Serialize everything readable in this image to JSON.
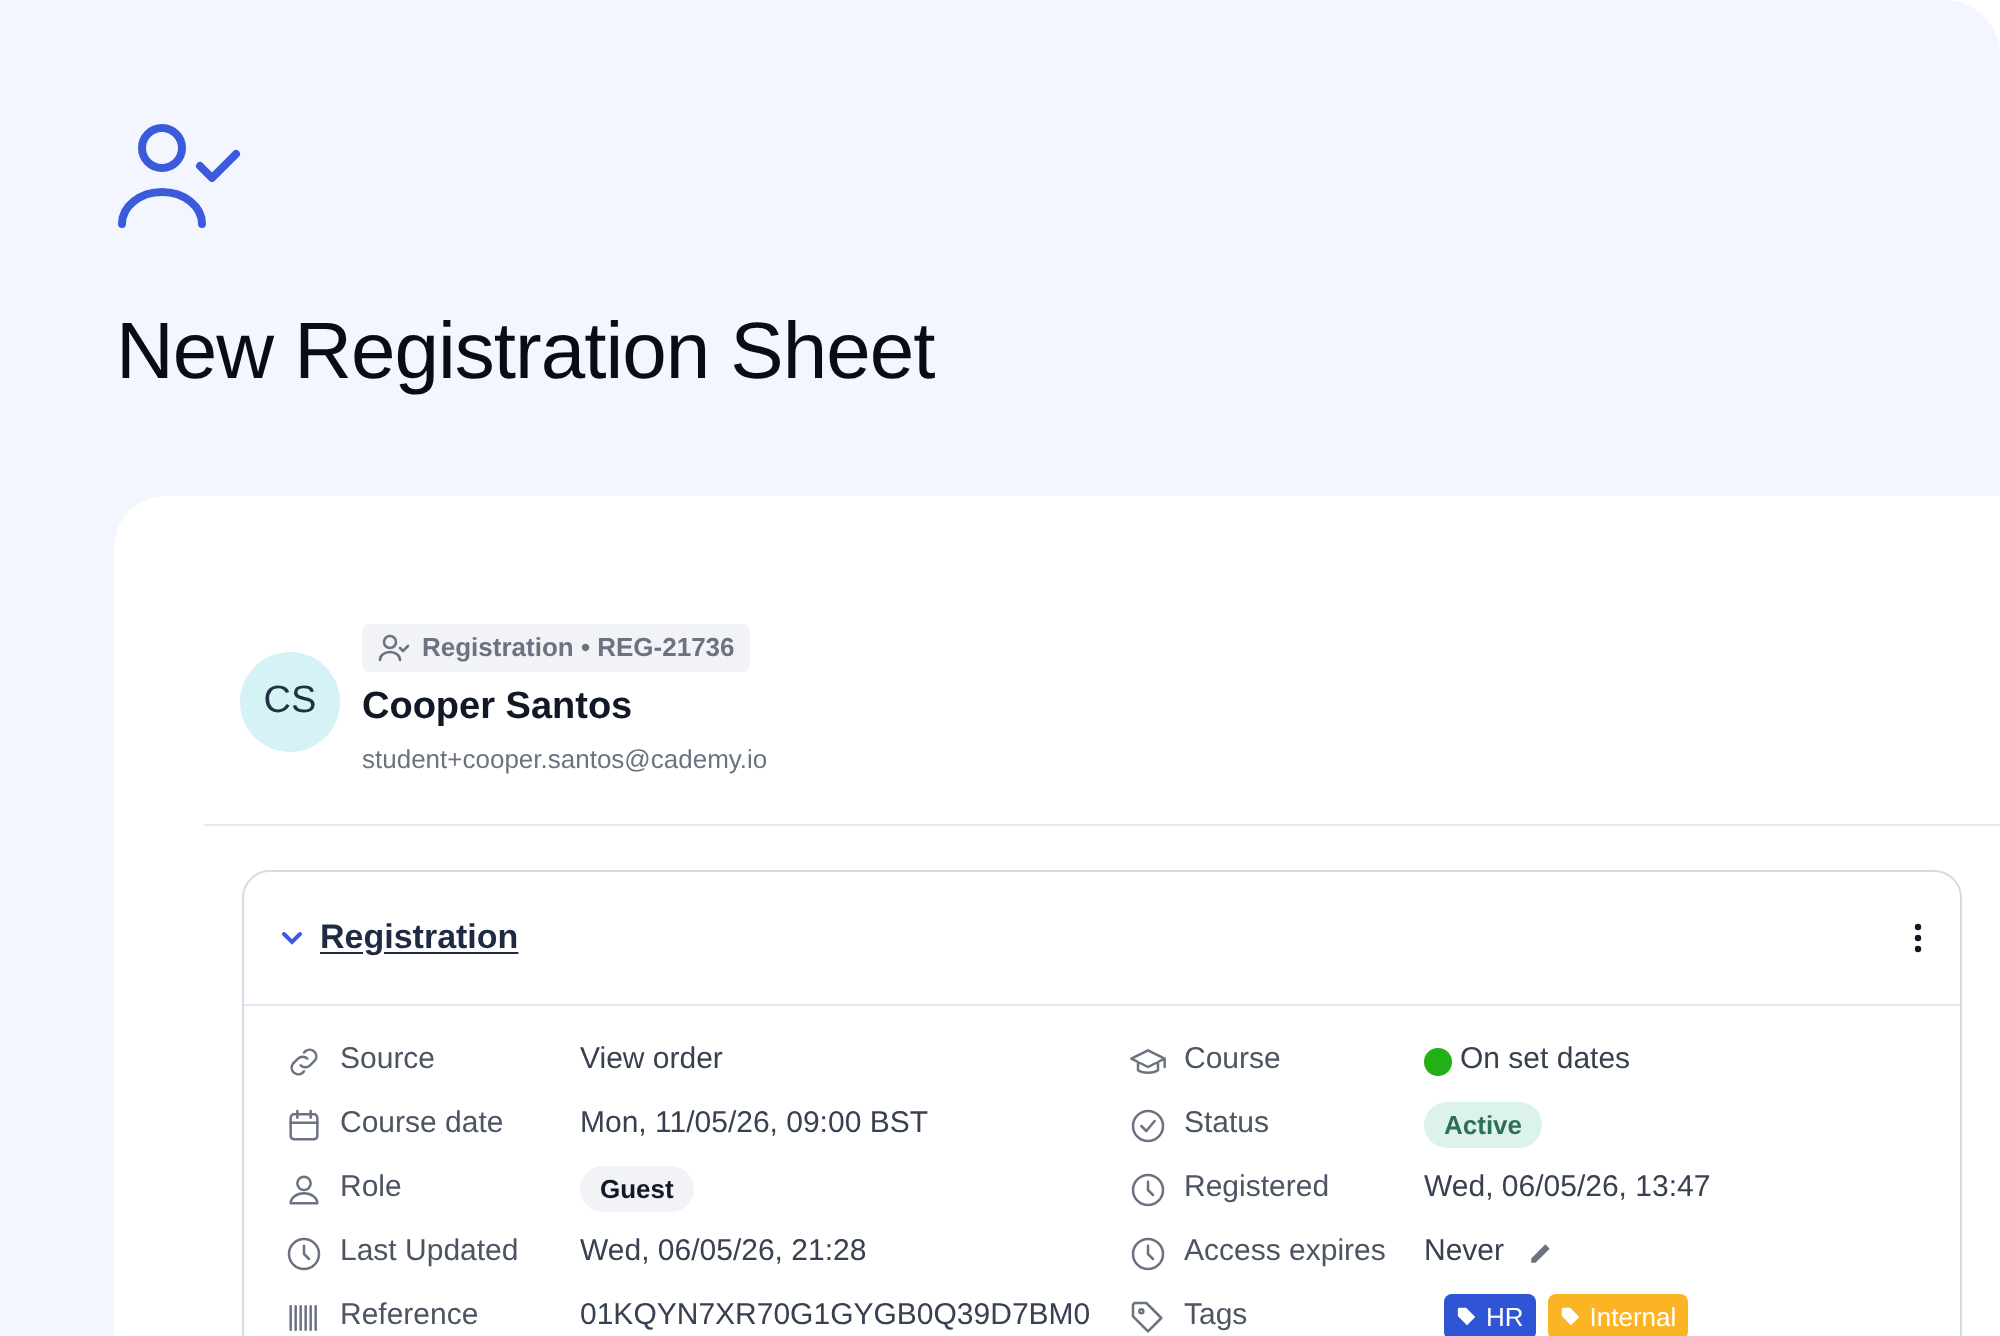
{
  "page": {
    "title": "New Registration Sheet"
  },
  "record": {
    "avatar_initials": "CS",
    "badge": "Registration • REG-21736",
    "name": "Cooper Santos",
    "email": "student+cooper.santos@cademy.io"
  },
  "section": {
    "title": "Registration",
    "expanded": true,
    "left_fields": [
      {
        "label": "Source",
        "kind": "text",
        "value": "View order"
      },
      {
        "label": "Course date",
        "kind": "text",
        "value": "Mon, 11/05/26, 09:00 BST"
      },
      {
        "label": "Role",
        "kind": "pill",
        "value": "Guest"
      },
      {
        "label": "Last Updated",
        "kind": "text",
        "value": "Wed, 06/05/26, 21:28"
      },
      {
        "label": "Reference",
        "kind": "text",
        "value": "01KQYN7XR70G1GYGB0Q39D7BM0"
      }
    ],
    "right_fields": [
      {
        "label": "Course",
        "kind": "dot",
        "value": "On set dates",
        "color": "#22b014"
      },
      {
        "label": "Status",
        "kind": "status",
        "value": "Active"
      },
      {
        "label": "Registered",
        "kind": "text",
        "value": "Wed, 06/05/26, 13:47"
      },
      {
        "label": "Access expires",
        "kind": "editable",
        "value": "Never"
      },
      {
        "label": "Tags",
        "kind": "tags",
        "tags": [
          {
            "label": "HR",
            "color": "#2f55d4"
          },
          {
            "label": "Internal",
            "color": "#fbb524"
          }
        ]
      }
    ]
  }
}
